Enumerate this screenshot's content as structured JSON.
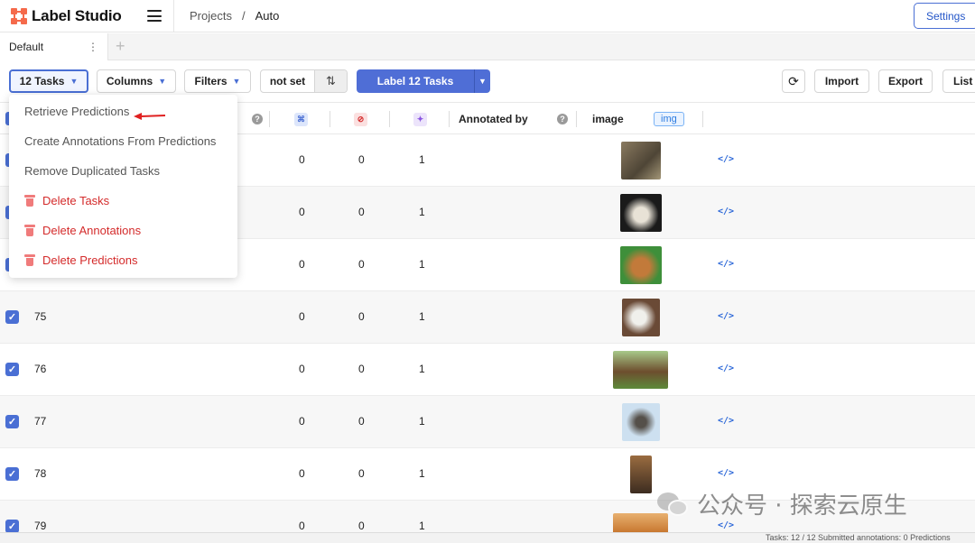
{
  "app": {
    "name": "Label Studio"
  },
  "breadcrumb": {
    "projects": "Projects",
    "separator": "/",
    "current": "Auto"
  },
  "header": {
    "settings_label": "Settings"
  },
  "tabs": [
    {
      "label": "Default",
      "menu": "⋮"
    }
  ],
  "tab_add": "+",
  "toolbar": {
    "tasks_label": "12 Tasks",
    "columns_label": "Columns",
    "filters_label": "Filters",
    "order_label": "not set",
    "label_tasks_label": "Label 12 Tasks",
    "import_label": "Import",
    "export_label": "Export",
    "list_label": "List"
  },
  "dropdown": {
    "items": [
      {
        "label": "Retrieve Predictions",
        "danger": false
      },
      {
        "label": "Create Annotations From Predictions",
        "danger": false
      },
      {
        "label": "Remove Duplicated Tasks",
        "danger": false
      },
      {
        "label": "Delete Tasks",
        "danger": true
      },
      {
        "label": "Delete Annotations",
        "danger": true
      },
      {
        "label": "Delete Predictions",
        "danger": true
      }
    ]
  },
  "table": {
    "columns": {
      "annotated_by": "Annotated by",
      "image": "image",
      "image_tag": "img"
    },
    "rows": [
      {
        "id": "",
        "c1": "0",
        "c2": "0",
        "c3": "1",
        "thumb": "tabby-cat"
      },
      {
        "id": "",
        "c1": "0",
        "c2": "0",
        "c3": "1",
        "thumb": "white-black-cat"
      },
      {
        "id": "",
        "c1": "0",
        "c2": "0",
        "c3": "1",
        "thumb": "orange-cat"
      },
      {
        "id": "75",
        "c1": "0",
        "c2": "0",
        "c3": "1",
        "thumb": "white-dog"
      },
      {
        "id": "76",
        "c1": "0",
        "c2": "0",
        "c3": "1",
        "thumb": "german-shepherd"
      },
      {
        "id": "77",
        "c1": "0",
        "c2": "0",
        "c3": "1",
        "thumb": "husky"
      },
      {
        "id": "78",
        "c1": "0",
        "c2": "0",
        "c3": "1",
        "thumb": "brown-dog"
      },
      {
        "id": "79",
        "c1": "0",
        "c2": "0",
        "c3": "1",
        "thumb": "dogs-field"
      }
    ]
  },
  "footer": {
    "text": "Tasks: 12 / 12   Submitted annotations: 0   Predictions"
  },
  "watermark": {
    "text": "公众号 · 探索云原生"
  },
  "colors": {
    "accent": "#4f6ed6",
    "danger": "#d42b2b",
    "logo": "#f56a4b"
  }
}
